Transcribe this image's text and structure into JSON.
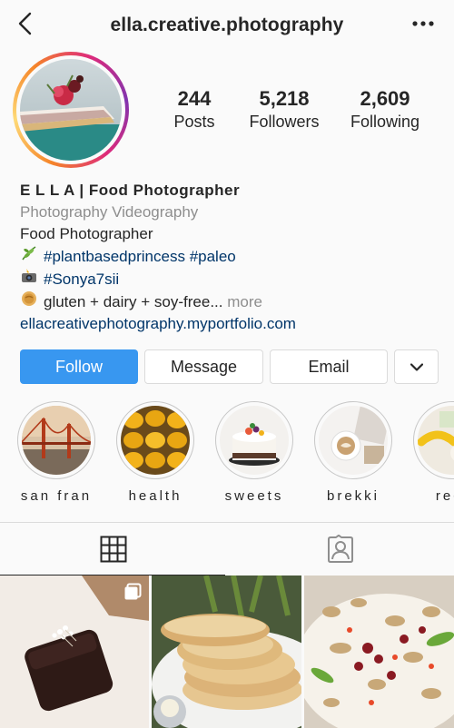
{
  "header": {
    "username": "ella.creative.photography"
  },
  "stats": [
    {
      "value": "244",
      "label": "Posts"
    },
    {
      "value": "5,218",
      "label": "Followers"
    },
    {
      "value": "2,609",
      "label": "Following"
    }
  ],
  "bio": {
    "name": "E L L A | Food Photographer",
    "category": "Photography Videography",
    "line1": "Food Photographer",
    "line2_tags": [
      "#plantbasedprincess",
      "#paleo"
    ],
    "line3_tag": "#Sonya7sii",
    "line4_text": "gluten + dairy + soy-free...",
    "line4_more": "more",
    "link": "ellacreativephotography.myportfolio.com"
  },
  "actions": {
    "follow": "Follow",
    "message": "Message",
    "email": "Email"
  },
  "highlights": [
    {
      "label": "san fran"
    },
    {
      "label": "health"
    },
    {
      "label": "sweets"
    },
    {
      "label": "brekki"
    },
    {
      "label": "reci"
    }
  ],
  "icons": {
    "back": "chevron-left-icon",
    "more": "more-horizontal-icon",
    "grid": "grid-icon",
    "tagged": "tagged-person-icon",
    "dropdown": "chevron-down-icon",
    "carousel": "carousel-icon"
  },
  "colors": {
    "follow_button": "#3897f0",
    "link": "#003569",
    "muted": "#8e8e8e"
  }
}
